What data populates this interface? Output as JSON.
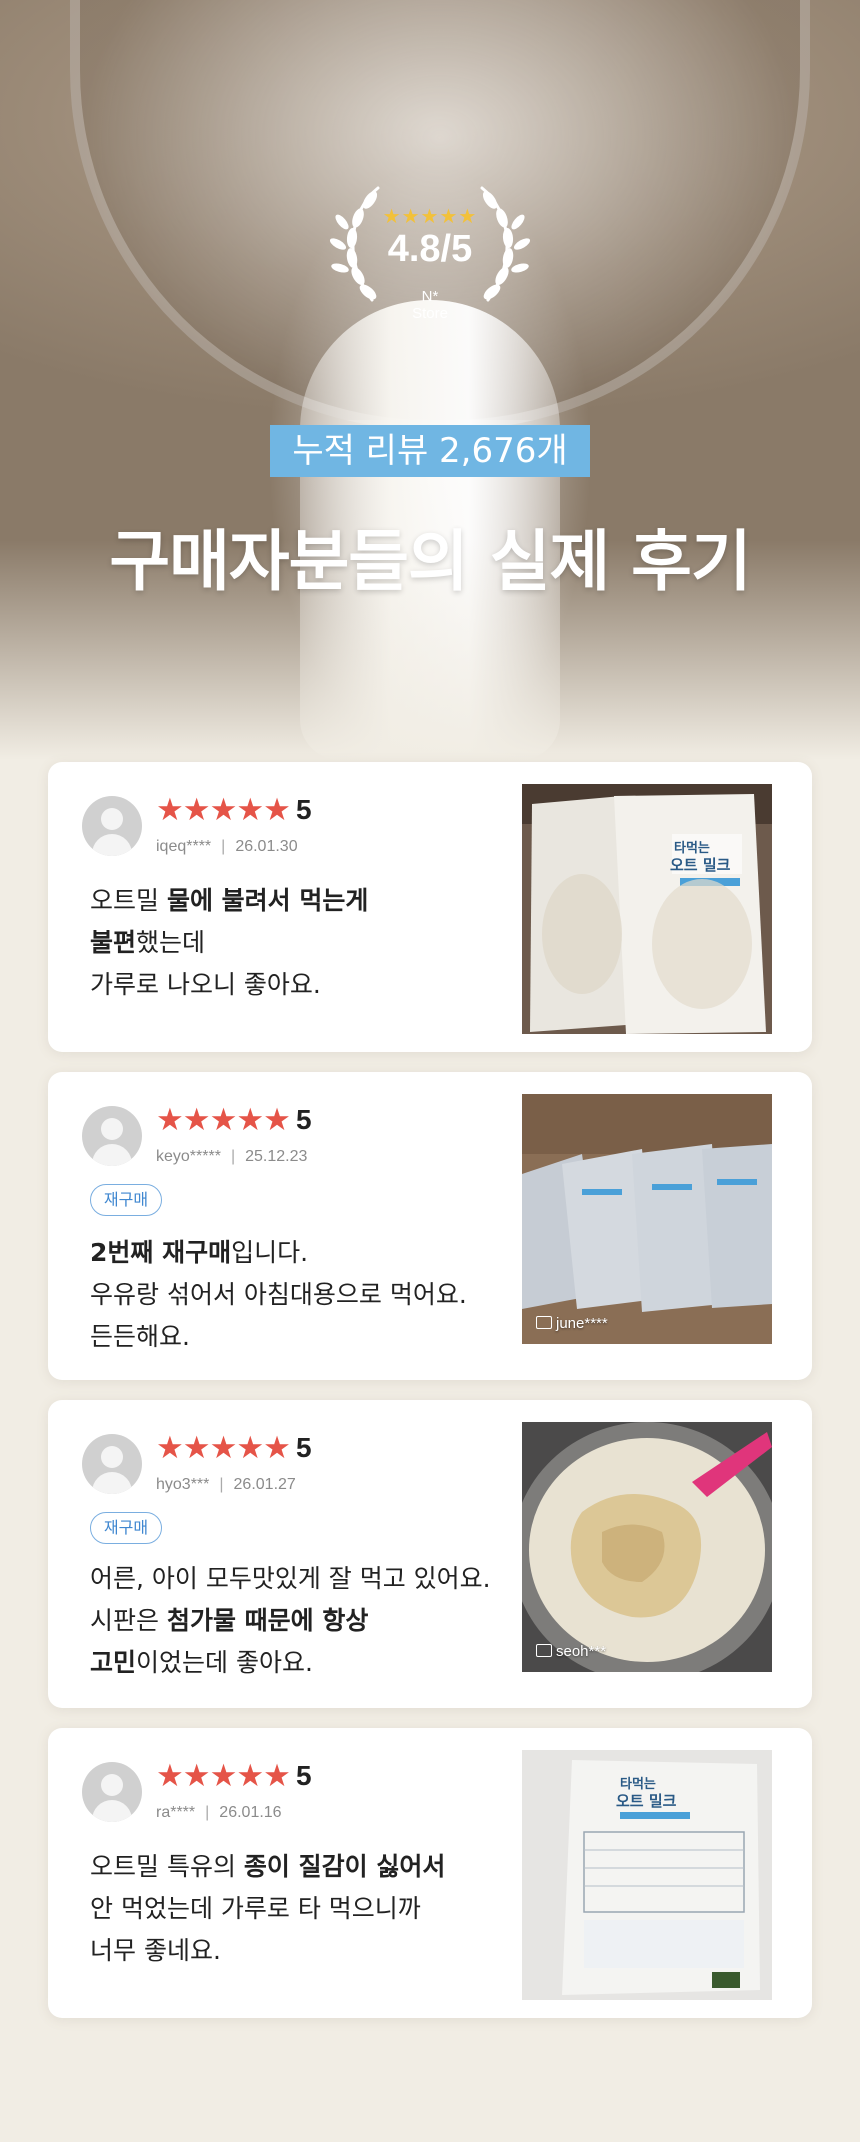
{
  "hero": {
    "rating_stars": "★★★★★",
    "rating_score": "4.8/5",
    "store_mark": "N*",
    "store_label": "Store",
    "cumulative_reviews": "누적 리뷰  2,676개",
    "headline": "구매자분들의 실제 후기"
  },
  "reviews": [
    {
      "stars": "★★★★★",
      "score": "5",
      "user": "iqeq****",
      "date": "26.01.30",
      "lines": [
        [
          {
            "t": "오트밀 "
          },
          {
            "t": "물에 불려서 먹는게",
            "b": true
          }
        ],
        [
          {
            "t": "불편",
            "b": true
          },
          {
            "t": "했는데"
          }
        ],
        [
          {
            "t": "가루로 나오니 좋아요."
          }
        ]
      ]
    },
    {
      "stars": "★★★★★",
      "score": "5",
      "user": "keyo*****",
      "date": "25.12.23",
      "tag": "재구매",
      "photo_watermark": "june****",
      "lines": [
        [
          {
            "t": "2번째 재구매",
            "b": true
          },
          {
            "t": "입니다."
          }
        ],
        [
          {
            "t": "우유랑 섞어서 아침대용으로 먹어요."
          }
        ],
        [
          {
            "t": "든든해요."
          }
        ]
      ]
    },
    {
      "stars": "★★★★★",
      "score": "5",
      "user": "hyo3***",
      "date": "26.01.27",
      "tag": "재구매",
      "photo_watermark": "seoh***",
      "lines": [
        [
          {
            "t": "어른, 아이 모두맛있게 잘 먹고 있어요."
          }
        ],
        [
          {
            "t": "시판은 "
          },
          {
            "t": "첨가물 때문에 항상",
            "b": true
          }
        ],
        [
          {
            "t": "고민",
            "b": true
          },
          {
            "t": "이었는데 좋아요."
          }
        ]
      ]
    },
    {
      "stars": "★★★★★",
      "score": "5",
      "user": "ra****",
      "date": "26.01.16",
      "lines": [
        [
          {
            "t": "오트밀 특유의 "
          },
          {
            "t": "종이 질감이 싫어서",
            "b": true
          }
        ],
        [
          {
            "t": "안 먹었는데 가루로 타 먹으니까"
          }
        ],
        [
          {
            "t": "너무 좋네요."
          }
        ]
      ]
    }
  ],
  "product_labels": {
    "brand_line1": "타먹는",
    "brand_line2": "오트 밀크"
  },
  "colors": {
    "star_red": "#e55448",
    "badge_blue": "#70b6e3",
    "tag_blue": "#3f87d0",
    "gold": "#f2c13a"
  }
}
